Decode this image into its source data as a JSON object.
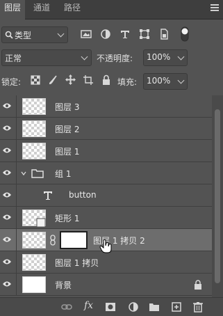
{
  "tabs": [
    {
      "label": "图层",
      "active": true
    },
    {
      "label": "通道",
      "active": false
    },
    {
      "label": "路径",
      "active": false
    }
  ],
  "filter": {
    "kind_label": "类型",
    "icons": [
      "image-filter-icon",
      "adjustment-filter-icon",
      "type-filter-icon",
      "shape-filter-icon",
      "smart-object-filter-icon",
      "filter-toggle-icon"
    ]
  },
  "blend": {
    "mode": "正常",
    "opacity_label": "不透明度:",
    "opacity_value": "100%"
  },
  "lock": {
    "label": "锁定:",
    "fill_label": "填充:",
    "fill_value": "100%"
  },
  "layers": [
    {
      "name": "图层 3",
      "type": "pixel"
    },
    {
      "name": "图层 2",
      "type": "pixel"
    },
    {
      "name": "图层 1",
      "type": "pixel"
    },
    {
      "name": "组 1",
      "type": "group"
    },
    {
      "name": "button",
      "type": "text"
    },
    {
      "name": "矩形 1",
      "type": "shape"
    },
    {
      "name": "图层 1 拷贝 2",
      "type": "masked",
      "selected": true
    },
    {
      "name": "图层 1 拷贝",
      "type": "pixel"
    },
    {
      "name": "背景",
      "type": "background",
      "locked": true
    }
  ],
  "bottom": {
    "fx_label": "fx"
  },
  "colors": {
    "panel": "#535353",
    "selected": "#6d6d6d"
  }
}
